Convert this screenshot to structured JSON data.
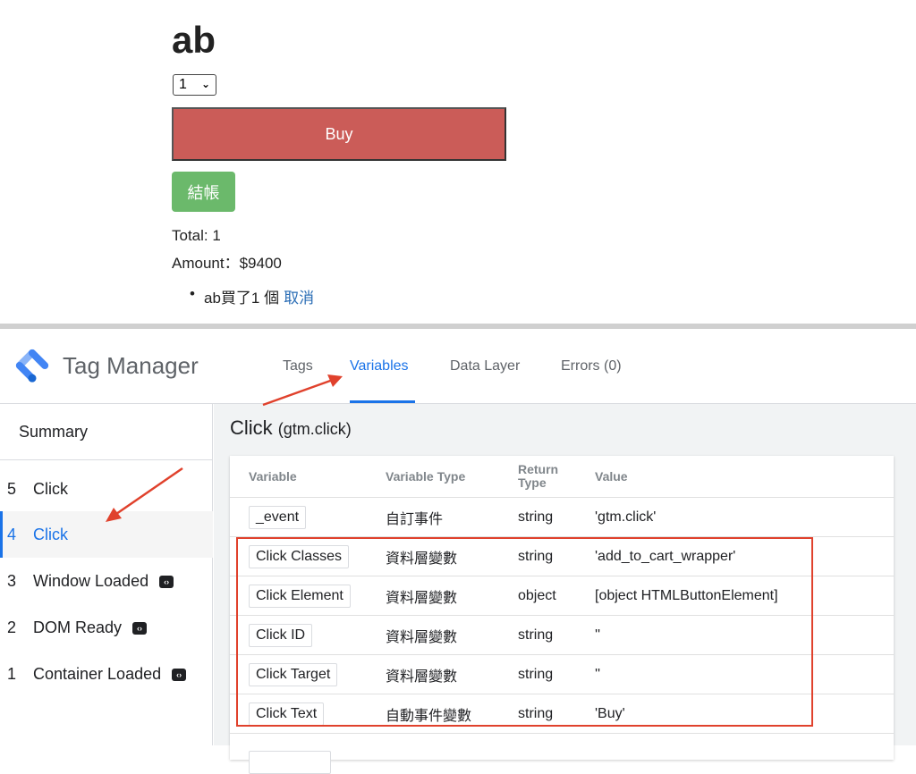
{
  "shop": {
    "product_title": "ab",
    "quantity": "1",
    "buy_label": "Buy",
    "checkout_label": "結帳",
    "total": "Total: 1",
    "amount": "Amount：$9400",
    "cart_item": "ab買了1 個",
    "cancel_label": "取消"
  },
  "tag_manager": {
    "app_title": "Tag Manager",
    "tabs": [
      {
        "label": "Tags"
      },
      {
        "label": "Variables"
      },
      {
        "label": "Data Layer"
      },
      {
        "label": "Errors (0)"
      }
    ],
    "active_tab": "Variables",
    "sidebar": {
      "summary_label": "Summary",
      "events": [
        {
          "num": "5",
          "label": "Click",
          "badge": false
        },
        {
          "num": "4",
          "label": "Click",
          "badge": false
        },
        {
          "num": "3",
          "label": "Window Loaded",
          "badge": true
        },
        {
          "num": "2",
          "label": "DOM Ready",
          "badge": true
        },
        {
          "num": "1",
          "label": "Container Loaded",
          "badge": true
        }
      ]
    },
    "content": {
      "title": "Click",
      "subtitle": "(gtm.click)",
      "columns": {
        "variable": "Variable",
        "variable_type": "Variable Type",
        "return_type_1": "Return",
        "return_type_2": "Type",
        "value": "Value"
      },
      "rows": [
        {
          "variable": "_event",
          "type": "自訂事件",
          "return_type": "string",
          "value": "'gtm.click'"
        },
        {
          "variable": "Click Classes",
          "type": "資料層變數",
          "return_type": "string",
          "value": "'add_to_cart_wrapper'"
        },
        {
          "variable": "Click Element",
          "type": "資料層變數",
          "return_type": "object",
          "value": "[object HTMLButtonElement]"
        },
        {
          "variable": "Click ID",
          "type": "資料層變數",
          "return_type": "string",
          "value": "''"
        },
        {
          "variable": "Click Target",
          "type": "資料層變數",
          "return_type": "string",
          "value": "''"
        },
        {
          "variable": "Click Text",
          "type": "自動事件變數",
          "return_type": "string",
          "value": "'Buy'"
        }
      ]
    }
  },
  "colors": {
    "accent": "#1a73e8",
    "buy_button": "#cb5c58",
    "checkout_button": "#6bb96b",
    "annotation": "#e0412c"
  }
}
